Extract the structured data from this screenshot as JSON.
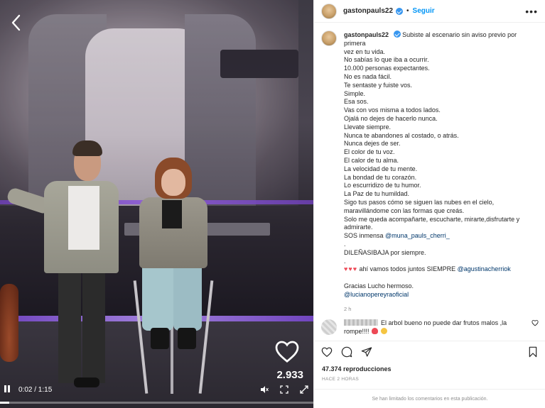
{
  "video": {
    "likes_count": "2.933",
    "current_time": "0:02 / 1:15",
    "progress": 0.03
  },
  "post": {
    "username": "gastonpauls22",
    "follow_label": "Seguir",
    "more_label": "•••",
    "caption_lines": [
      "Subiste al escenario sin aviso previo por primera",
      "vez en tu vida.",
      "No sabías lo que iba a ocurrir.",
      "10.000 personas expectantes.",
      "No es nada fácil.",
      "Te sentaste y fuiste vos.",
      "Simple.",
      "Esa sos.",
      "Vas con vos misma a todos lados.",
      "Ojalá no dejes de hacerlo nunca.",
      "Llevate siempre.",
      "Nunca te abandones al costado, o atrás.",
      "Nunca dejes de ser.",
      "El color de tu voz.",
      "El calor de tu alma.",
      "La velocidad de tu mente.",
      "La bondad de tu corazón.",
      "Lo escurridizo de tu humor.",
      "La Paz de tu humildad.",
      "Sigo tus pasos cómo se siguen las nubes en el cielo,",
      "maravillándome con las formas que creás.",
      "Solo me queda acompañarte, escucharte, mirarte,disfrutarte y",
      "admirarte."
    ],
    "sos_text": "SOS inmensa",
    "mention_1": "@muna_pauls_cherri_",
    "dot_line": ".",
    "dilena_line": "DILEÑASIBAJA por siempre.",
    "dot_line_2": ".",
    "hearts": "♥♥♥",
    "together_text": " ahí vamos todos juntos SIEMPRE",
    "mention_2": "@agustinacherriok",
    "thanks_line": "Gracias Lucho hermoso.",
    "mention_3": "@lucianopereyraoficial",
    "time_ago": "2 h"
  },
  "comment": {
    "text_line_1": "El arbol bueno no puede dar frutos malos ,la",
    "text_line_2": "rompe!!!!"
  },
  "stats": {
    "views": "47.374 reproducciones",
    "posted": "HACE 2 HORAS",
    "comments_limited": "Se han limitado los comentarios en esta publicación."
  },
  "colors": {
    "link_blue": "#0095f6",
    "mention_blue": "#00376b",
    "heart_red": "#ed4956",
    "verified_blue": "#3897f0"
  }
}
